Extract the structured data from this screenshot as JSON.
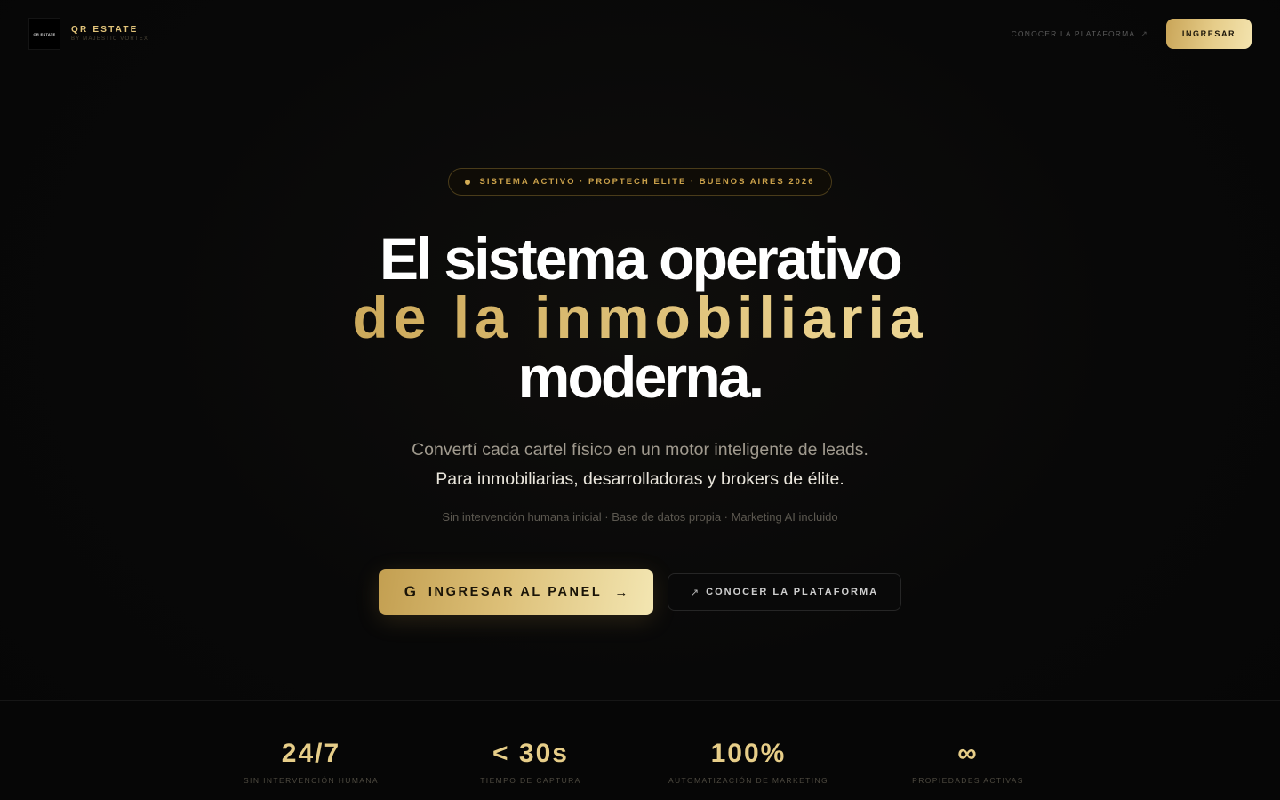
{
  "nav": {
    "logo_text": "QR ESTATE",
    "brand_title": "QR ESTATE",
    "brand_subtitle": "BY MAJESTIC VORTEX",
    "link_label": "CONOCER LA PLATAFORMA",
    "login_label": "INGRESAR"
  },
  "hero": {
    "badge": "SISTEMA ACTIVO · PROPTECH ELITE · BUENOS AIRES 2026",
    "headline_line1": "El sistema operativo",
    "headline_line2": "de la inmobiliaria",
    "headline_line3": "moderna.",
    "subtitle_line1": "Convertí cada cartel físico en un motor inteligente de leads.",
    "subtitle_line2": "Para inmobiliarias, desarrolladoras y brokers de élite.",
    "features_line": "Sin intervención humana inicial · Base de datos propia · Marketing AI incluido",
    "primary_cta": "INGRESAR AL PANEL",
    "secondary_cta": "CONOCER LA PLATAFORMA"
  },
  "stats": [
    {
      "value": "24/7",
      "label": "SIN INTERVENCIÓN HUMANA"
    },
    {
      "value": "< 30s",
      "label": "TIEMPO DE CAPTURA"
    },
    {
      "value": "100%",
      "label": "AUTOMATIZACIÓN DE MARKETING"
    },
    {
      "value": "∞",
      "label": "PROPIEDADES ACTIVAS"
    }
  ],
  "colors": {
    "background": "#070707",
    "gold_accent": "#e2c47a",
    "gold_light": "#f3e3ae"
  }
}
